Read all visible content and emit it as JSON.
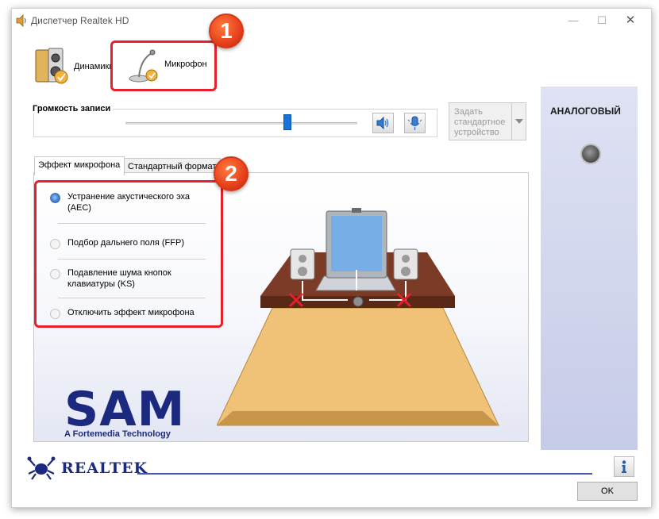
{
  "window": {
    "title": "Диспетчер Realtek HD",
    "controls": {
      "minimize": "—",
      "maximize": "☐",
      "close": "✕"
    }
  },
  "device_tabs": [
    {
      "label": "Динамики",
      "icon": "speakers-icon"
    },
    {
      "label": "Микрофон",
      "icon": "microphone-icon",
      "selected": true
    }
  ],
  "recording_volume": {
    "title": "Громкость записи",
    "level": 0.7,
    "mute_icon": "speaker-volume-icon",
    "mic_icon": "microphone-boost-icon"
  },
  "default_device_button": {
    "label": "Задать стандартное устройство",
    "enabled": false
  },
  "effect_tabs": [
    {
      "label": "Эффект микрофона",
      "active": true
    },
    {
      "label": "Стандартный формат",
      "active": false
    }
  ],
  "mic_effects": [
    {
      "label": "Устранение акустического эха (AEC)",
      "checked": true
    },
    {
      "label": "Подбор дальнего поля (FFP)",
      "checked": false
    },
    {
      "label": "Подавление шума кнопок клавиатуры (KS)",
      "checked": false
    },
    {
      "label": "Отключить эффект микрофона",
      "checked": false
    }
  ],
  "sam_logo": {
    "name": "SAM",
    "tagline": "A Fortemedia Technology"
  },
  "connector_panel": {
    "title": "АНАЛОГОВЫЙ"
  },
  "footer": {
    "brand": "REALTEK",
    "ok_label": "OK",
    "info_icon": "info-icon"
  },
  "annotations": [
    {
      "number": "1"
    },
    {
      "number": "2"
    }
  ],
  "colors": {
    "highlight": "#e8202b",
    "badge": "#e8411d",
    "slider_thumb": "#1673d9",
    "brand_blue": "#1b2a7e",
    "side_panel": "#c6cbe8"
  }
}
